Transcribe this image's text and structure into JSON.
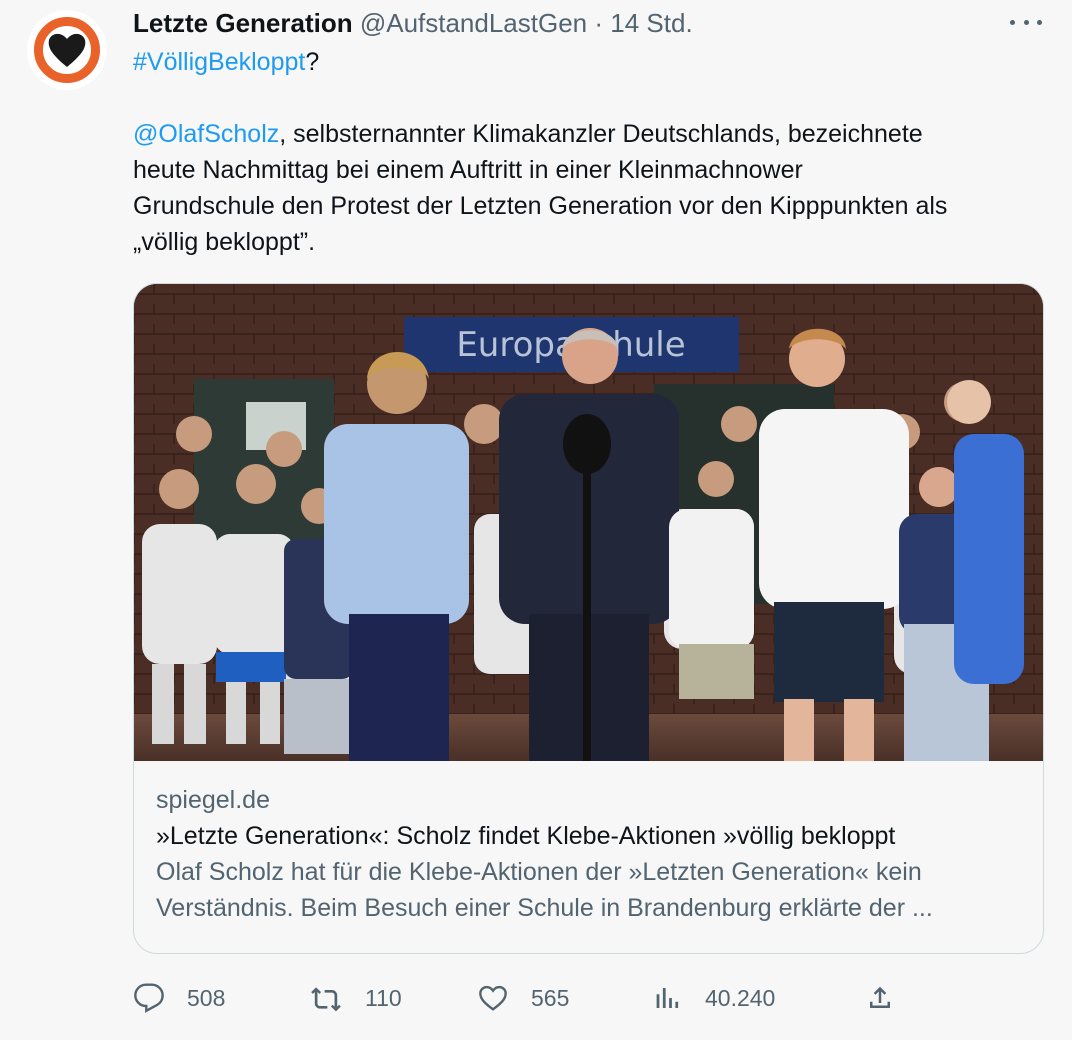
{
  "author": {
    "display_name": "Letzte Generation",
    "handle": "@AufstandLastGen",
    "separator": "·",
    "time": "14 Std."
  },
  "tweet": {
    "hashtag": "#VölligBekloppt",
    "hashtag_suffix": "?",
    "mention": "@OlafScholz",
    "line1_rest": ", selbsternannter Klimakanzler Deutschlands, bezeichnete",
    "line2": "heute Nachmittag bei einem Auftritt in einer Kleinmachnower",
    "line3": "Grundschule den Protest der Letzten Generation vor den Kipppunkten als",
    "line4": "„völlig bekloppt”."
  },
  "card": {
    "sign_text": "Europaschule",
    "domain": "spiegel.de",
    "title": "»Letzte Generation«: Scholz findet Klebe-Aktionen »völlig bekloppt",
    "desc_line1": "Olaf Scholz hat für die Klebe-Aktionen der »Letzten Generation« kein",
    "desc_line2": "Verständnis. Beim Besuch einer Schule in Brandenburg erklärte der ..."
  },
  "actions": {
    "replies": "508",
    "retweets": "110",
    "likes": "565",
    "views": "40.240"
  },
  "icons": {
    "more": "more-dots-icon",
    "reply": "reply-icon",
    "retweet": "retweet-icon",
    "like": "heart-icon",
    "views": "views-chart-icon",
    "share": "share-icon"
  },
  "colors": {
    "link": "#1d9bf0",
    "secondary": "#536471",
    "avatar_ring": "#e8622a",
    "avatar_heart": "#1a1a1a"
  }
}
